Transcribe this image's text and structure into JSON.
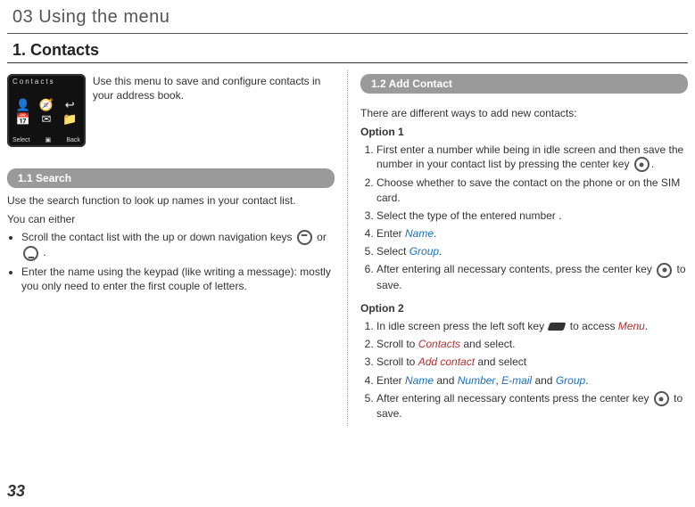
{
  "chapter_title": "03 Using the menu",
  "section_title": "1. Contacts",
  "page_number": "33",
  "phone": {
    "title": "Contacts",
    "btn_select": "Select",
    "btn_back": "Back"
  },
  "intro_text": "Use this menu to save and configure contacts in your address book.",
  "left": {
    "subhead": "1.1  Search",
    "p1": "Use the search function to look up names in your contact list.",
    "p2": "You can either",
    "b1a": "Scroll the contact list with the up or down navigation keys ",
    "b1_or": " or ",
    "b1_end": " .",
    "b2": "Enter the name using the keypad (like writing a message): mostly you only need to enter the first couple of letters."
  },
  "right": {
    "subhead": "1.2  Add Contact",
    "intro": "There are different ways to add new contacts:",
    "opt1_title": "Option 1",
    "opt1": {
      "s1a": "First enter a number while being in idle screen and then save the number in your contact list by pressing the center key ",
      "s1b": ".",
      "s2": "Choose whether to save the contact on the phone or on the SIM card.",
      "s3": "Select the type of the entered number .",
      "s4a": "Enter ",
      "s4b": ".",
      "s5a": "Select ",
      "s5b": ".",
      "s6a": "After entering all necessary contents, press the center key ",
      "s6b": " to save."
    },
    "opt2_title": "Option 2",
    "opt2": {
      "s1a": "In idle screen press the left soft key ",
      "s1b": " to access ",
      "s1c": ".",
      "s2a": "Scroll to ",
      "s2b": " and select.",
      "s3a": "Scroll to ",
      "s3b": "  and select",
      "s4a": "Enter ",
      "s4_and1": " and ",
      "s4_comma": ", ",
      "s4_and2": " and ",
      "s4b": ".",
      "s5a": "After entering all necessary contents press the center key ",
      "s5b": " to save."
    },
    "kw": {
      "name": "Name",
      "group": "Group",
      "number": "Number",
      "email": "E-mail",
      "menu": "Menu",
      "contacts": "Contacts",
      "add_contact": "Add contact"
    }
  }
}
